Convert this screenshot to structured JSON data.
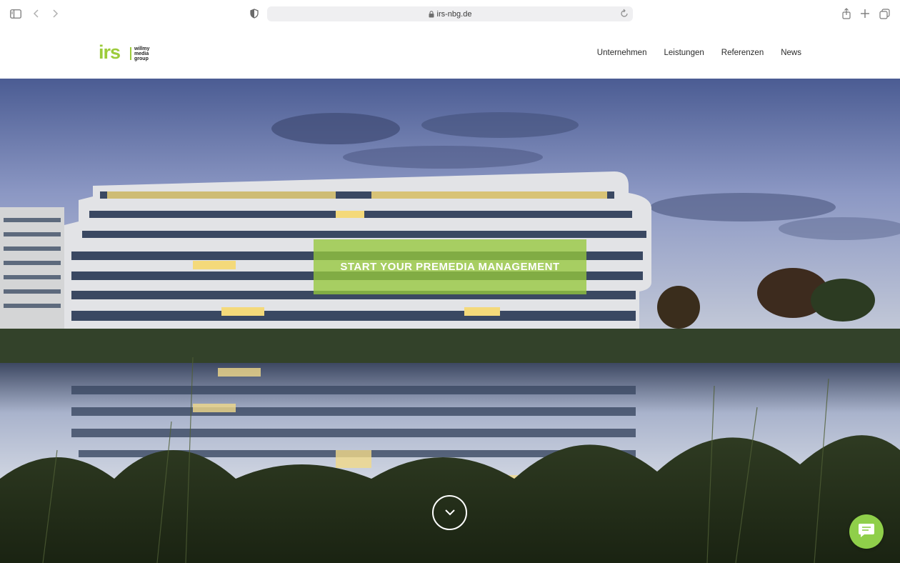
{
  "browser": {
    "url": "irs-nbg.de",
    "icons": [
      "sidebar-icon",
      "back-icon",
      "forward-icon",
      "shield-icon",
      "lock-icon",
      "reload-icon",
      "share-icon",
      "new-tab-icon",
      "tabs-icon"
    ]
  },
  "header": {
    "logo_text": "irs",
    "logo_group_lines": [
      "willmy",
      "media",
      "group"
    ],
    "nav": [
      {
        "label": "Unternehmen"
      },
      {
        "label": "Leistungen"
      },
      {
        "label": "Referenzen"
      },
      {
        "label": "News"
      }
    ]
  },
  "hero": {
    "cta_label": "START YOUR PREMEDIA MANAGEMENT",
    "scroll_icon": "chevron-down-icon",
    "chat_icon": "chat-icon"
  },
  "colors": {
    "brand_green": "#9ccb3b",
    "chat_green": "#8fcf4a",
    "cta_overlay": "rgba(150,200,60,0.78)"
  }
}
